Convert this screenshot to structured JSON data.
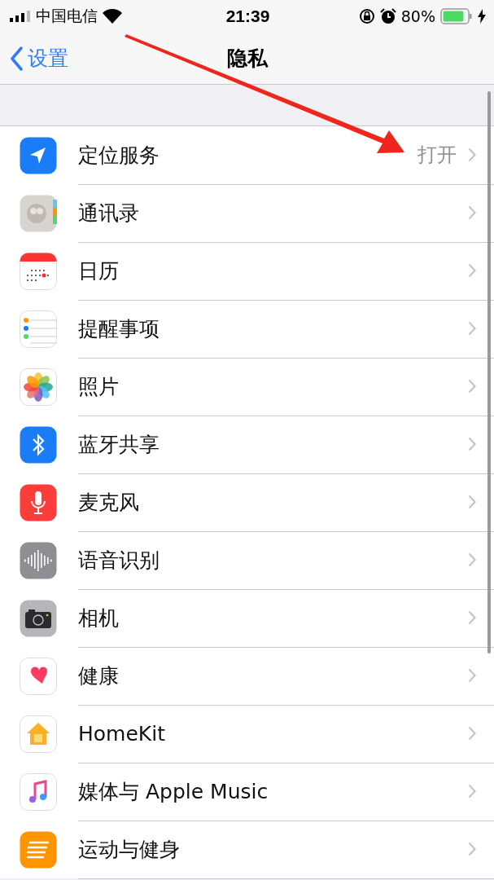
{
  "status_bar": {
    "carrier": "中国电信",
    "time": "21:39",
    "battery": "80%"
  },
  "nav_bar": {
    "back": "设置",
    "title": "隐私"
  },
  "rows": [
    {
      "label": "定位服务",
      "value": "打开"
    },
    {
      "label": "通讯录"
    },
    {
      "label": "日历"
    },
    {
      "label": "提醒事项"
    },
    {
      "label": "照片"
    },
    {
      "label": "蓝牙共享"
    },
    {
      "label": "麦克风"
    },
    {
      "label": "语音识别"
    },
    {
      "label": "相机"
    },
    {
      "label": "健康"
    },
    {
      "label": "HomeKit"
    },
    {
      "label": "媒体与 Apple Music"
    },
    {
      "label": "运动与健身"
    }
  ]
}
